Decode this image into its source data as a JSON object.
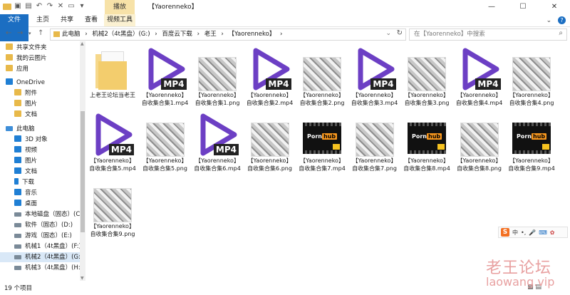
{
  "title_bar": {
    "context_tab": "播放",
    "window_title": "【Yaorenneko】",
    "minimize": "—",
    "maximize": "☐",
    "close": "✕"
  },
  "ribbon": {
    "tabs": [
      {
        "label": "文件"
      },
      {
        "label": "主页"
      },
      {
        "label": "共享"
      },
      {
        "label": "查看"
      },
      {
        "label": "视频工具"
      }
    ],
    "expand": "⌄",
    "help": "?"
  },
  "address": {
    "crumbs": [
      "此电脑",
      "›",
      "机械2（4t黑盘）(G:)",
      "›",
      "百度云下载",
      "›",
      "老王",
      "›",
      "【Yaorenneko】",
      "›"
    ],
    "search_placeholder": "在【Yaorenneko】中搜索"
  },
  "sidebar": {
    "items": [
      {
        "label": "共享文件夹",
        "icon": "folder-icon"
      },
      {
        "label": "我的云图片",
        "icon": "folder-icon"
      },
      {
        "label": "应用",
        "icon": "folder-icon"
      },
      {
        "label": "OneDrive",
        "icon": "cloud-icon"
      },
      {
        "label": "附件",
        "icon": "folder-icon"
      },
      {
        "label": "图片",
        "icon": "folder-icon"
      },
      {
        "label": "文档",
        "icon": "folder-icon"
      },
      {
        "label": "此电脑",
        "icon": "pc-icon"
      },
      {
        "label": "3D 对象",
        "icon": "cube-icon"
      },
      {
        "label": "视频",
        "icon": "video-icon"
      },
      {
        "label": "图片",
        "icon": "picture-icon"
      },
      {
        "label": "文档",
        "icon": "document-icon"
      },
      {
        "label": "下载",
        "icon": "download-icon"
      },
      {
        "label": "音乐",
        "icon": "music-icon"
      },
      {
        "label": "桌面",
        "icon": "desktop-icon"
      },
      {
        "label": "本地磁盘（固态）(C:)",
        "icon": "drive-icon"
      },
      {
        "label": "软件（固态）(D:)",
        "icon": "drive-icon"
      },
      {
        "label": "游戏（固态）(E:)",
        "icon": "drive-icon"
      },
      {
        "label": "机械1（4t黑盘）(F:)",
        "icon": "drive-icon"
      },
      {
        "label": "机械2（4t黑盘）(G:)",
        "icon": "drive-icon"
      },
      {
        "label": "机械3（4t黑盘）(H:)",
        "icon": "drive-icon"
      }
    ]
  },
  "files": [
    {
      "name": "上老王论坛当老王",
      "type": "folder"
    },
    {
      "name": "【Yaorenneko】自收集合集1.mp4",
      "type": "mp4"
    },
    {
      "name": "【Yaorenneko】自收集合集1.png",
      "type": "png"
    },
    {
      "name": "【Yaorenneko】自收集合集2.mp4",
      "type": "mp4"
    },
    {
      "name": "【Yaorenneko】自收集合集2.png",
      "type": "png"
    },
    {
      "name": "【Yaorenneko】自收集合集3.mp4",
      "type": "mp4"
    },
    {
      "name": "【Yaorenneko】自收集合集3.png",
      "type": "png"
    },
    {
      "name": "【Yaorenneko】自收集合集4.mp4",
      "type": "mp4"
    },
    {
      "name": "【Yaorenneko】自收集合集4.png",
      "type": "png"
    },
    {
      "name": "【Yaorenneko】自收集合集5.mp4",
      "type": "mp4"
    },
    {
      "name": "【Yaorenneko】自收集合集5.png",
      "type": "png"
    },
    {
      "name": "【Yaorenneko】自收集合集6.mp4",
      "type": "mp4"
    },
    {
      "name": "【Yaorenneko】自收集合集6.png",
      "type": "png"
    },
    {
      "name": "【Yaorenneko】自收集合集7.mp4",
      "type": "phvid"
    },
    {
      "name": "【Yaorenneko】自收集合集7.png",
      "type": "png"
    },
    {
      "name": "【Yaorenneko】自收集合集8.mp4",
      "type": "phvid"
    },
    {
      "name": "【Yaorenneko】自收集合集8.png",
      "type": "png"
    },
    {
      "name": "【Yaorenneko】自收集合集9.mp4",
      "type": "phvid"
    },
    {
      "name": "【Yaorenneko】自收集合集9.png",
      "type": "png"
    }
  ],
  "thumb_text": {
    "mp4_badge": "MP4",
    "ph_left": "Porn",
    "ph_right": "hub"
  },
  "status": {
    "count": "19 个项目"
  },
  "ime": {
    "logo": "S",
    "lang": "中",
    "punct": "•,",
    "mic": "🎤"
  },
  "watermark": {
    "line1": "老王论坛",
    "line2": "laowang.vip"
  },
  "colors": {
    "accent": "#1b6ec2",
    "play_purple": "#6c3fc4",
    "context_tab": "#f7e2a8"
  }
}
